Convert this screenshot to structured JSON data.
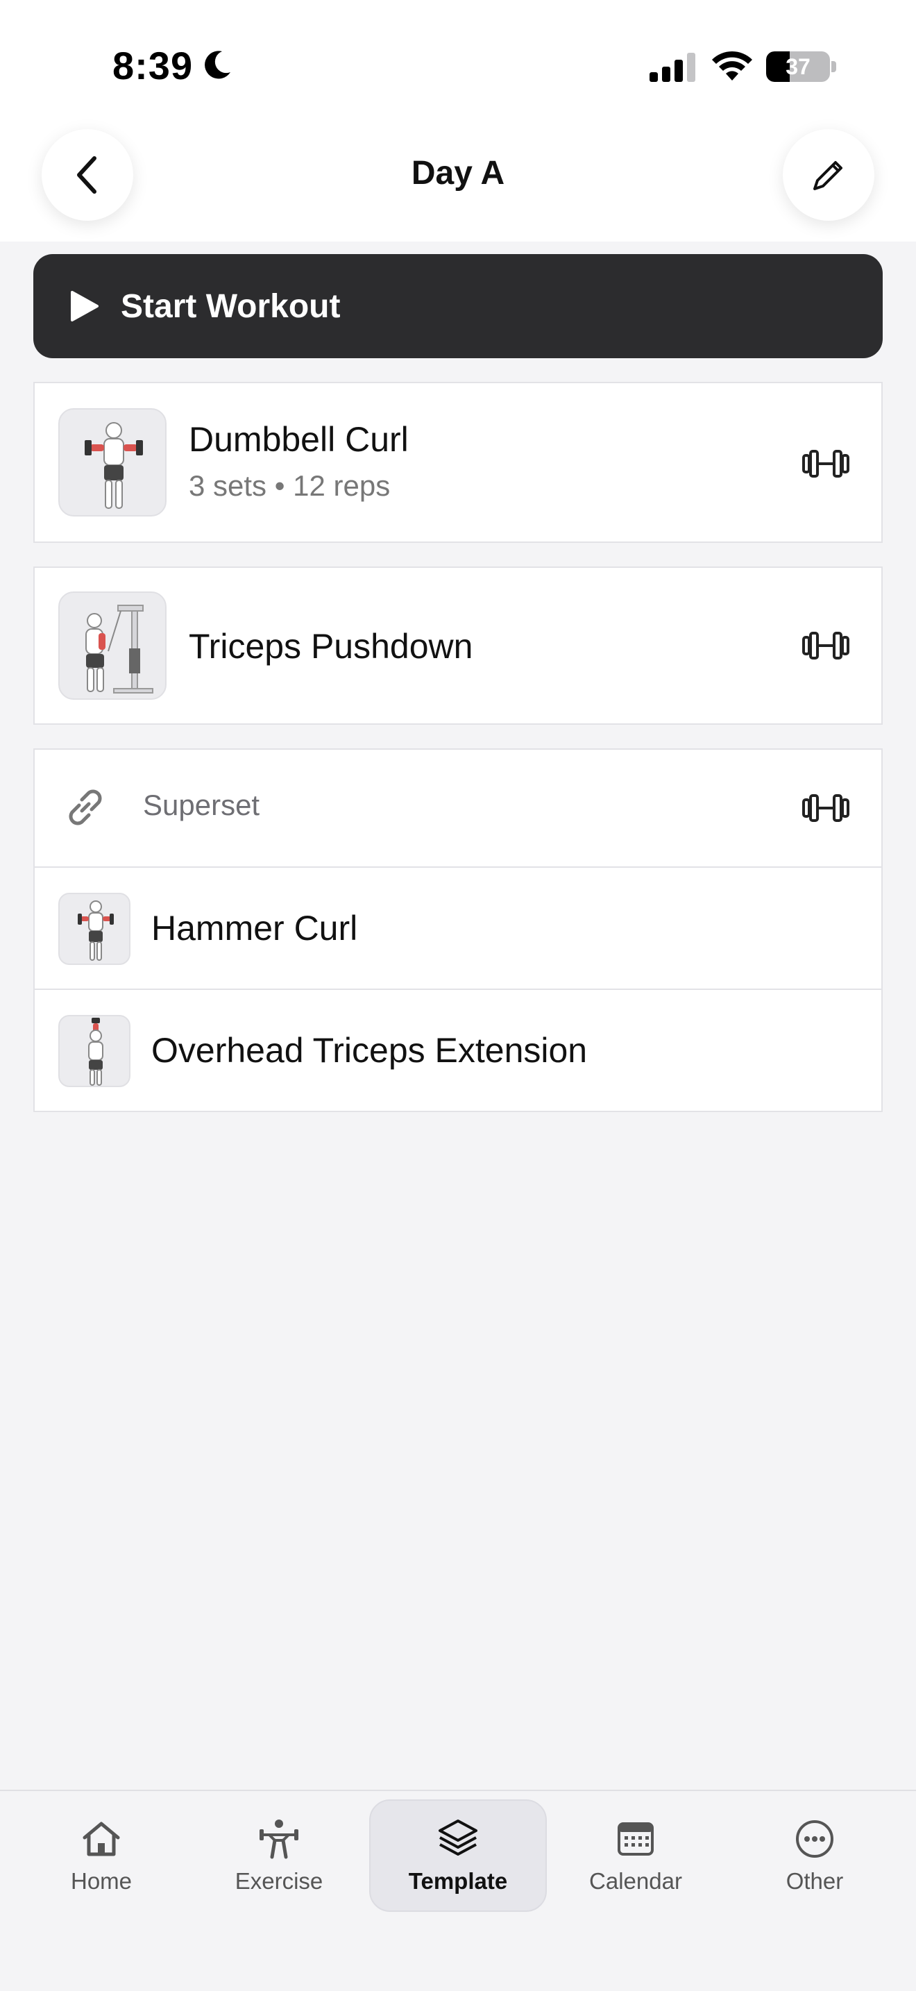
{
  "status": {
    "time": "8:39",
    "battery": "37",
    "battery_level": 0.37
  },
  "header": {
    "title": "Day A"
  },
  "actions": {
    "start_workout": "Start Workout"
  },
  "exercises": [
    {
      "name": "Dumbbell Curl",
      "sets": "3 sets",
      "separator": "•",
      "reps": "12 reps"
    },
    {
      "name": "Triceps Pushdown"
    }
  ],
  "superset": {
    "label": "Superset",
    "items": [
      {
        "name": "Hammer Curl"
      },
      {
        "name": "Overhead Triceps Extension"
      }
    ]
  },
  "tabbar": {
    "tabs": [
      {
        "label": "Home",
        "icon": "home-icon"
      },
      {
        "label": "Exercise",
        "icon": "weightlifter-icon"
      },
      {
        "label": "Template",
        "icon": "layers-icon",
        "active": true
      },
      {
        "label": "Calendar",
        "icon": "calendar-icon"
      },
      {
        "label": "Other",
        "icon": "more-icon"
      }
    ]
  },
  "colors": {
    "accent_dark": "#2c2c2e",
    "background": "#f4f4f6",
    "card": "#ffffff"
  }
}
